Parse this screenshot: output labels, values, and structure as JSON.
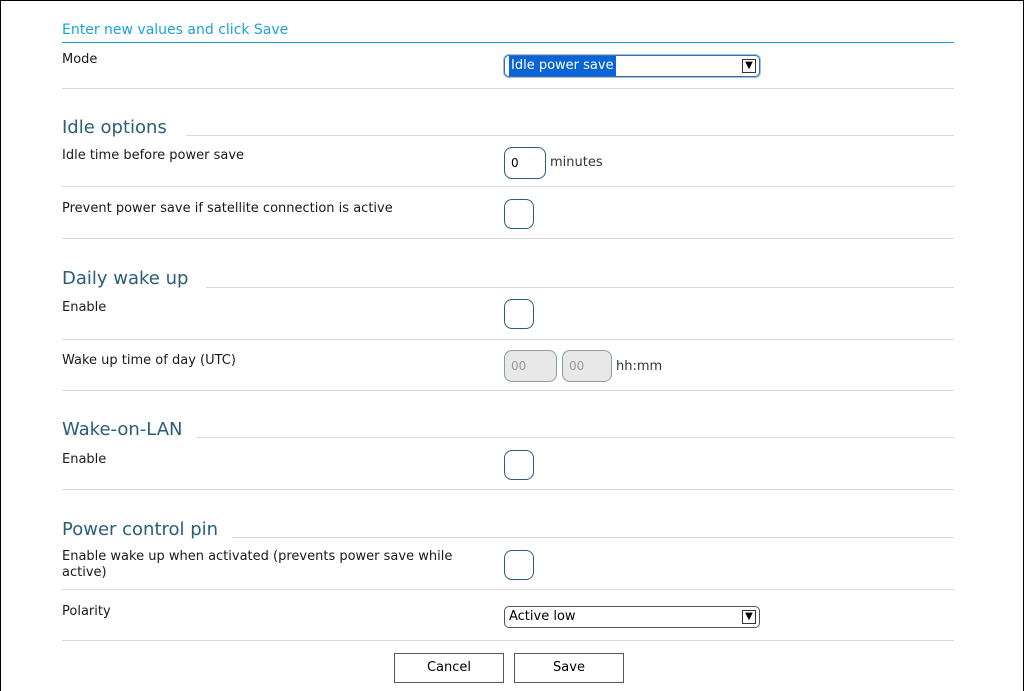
{
  "header": {
    "title": "Enter new values and click Save"
  },
  "mode": {
    "label": "Mode",
    "value": "Idle power save"
  },
  "idle_options": {
    "title": "Idle options",
    "idle_time": {
      "label": "Idle time before power save",
      "value": "0",
      "unit": "minutes"
    },
    "prevent_power_save": {
      "label": "Prevent power save if satellite connection is active",
      "checked": false
    }
  },
  "daily_wake_up": {
    "title": "Daily wake up",
    "enable": {
      "label": "Enable",
      "checked": false
    },
    "wake_time": {
      "label": "Wake up time of day (UTC)",
      "hours": "00",
      "minutes": "00",
      "format": "hh:mm"
    }
  },
  "wake_on_lan": {
    "title": "Wake-on-LAN",
    "enable": {
      "label": "Enable",
      "checked": false
    }
  },
  "power_control_pin": {
    "title": "Power control pin",
    "enable_wake": {
      "label": "Enable wake up when activated (prevents power save while active)",
      "checked": false
    },
    "polarity": {
      "label": "Polarity",
      "value": "Active low"
    }
  },
  "buttons": {
    "cancel": "Cancel",
    "save": "Save"
  },
  "colors": {
    "accent": "#1ba1dc",
    "section": "#2a5d78",
    "selection": "#0a64d6"
  }
}
